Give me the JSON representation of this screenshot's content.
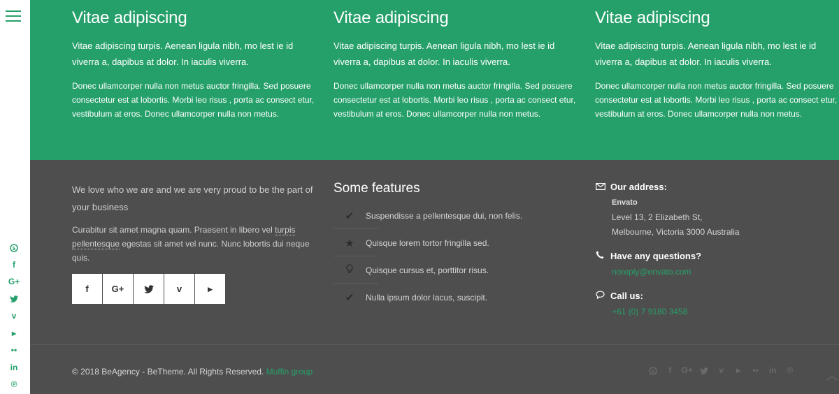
{
  "sidebar": {
    "social_icons": [
      "skype-icon",
      "facebook-icon",
      "google-plus-icon",
      "twitter-icon",
      "vimeo-icon",
      "youtube-icon",
      "flickr-icon",
      "linkedin-icon",
      "pinterest-icon"
    ]
  },
  "columns": [
    {
      "title": "Vitae adipiscing",
      "lead": "Vitae adipiscing turpis. Aenean ligula nibh, mo lest ie id viverra a, dapibus at dolor. In iaculis viverra.",
      "body": "Donec ullamcorper nulla non metus auctor fringilla. Sed posuere consectetur est at lobortis. Morbi leo risus , porta ac consect etur, vestibulum at eros. Donec ullamcorper nulla non metus."
    },
    {
      "title": "Vitae adipiscing",
      "lead": "Vitae adipiscing turpis. Aenean ligula nibh, mo lest ie id viverra a, dapibus at dolor. In iaculis viverra.",
      "body": "Donec ullamcorper nulla non metus auctor fringilla. Sed posuere consectetur est at lobortis. Morbi leo risus , porta ac consect etur, vestibulum at eros. Donec ullamcorper nulla non metus."
    },
    {
      "title": "Vitae adipiscing",
      "lead": "Vitae adipiscing turpis. Aenean ligula nibh, mo lest ie id viverra a, dapibus at dolor. In iaculis viverra.",
      "body": "Donec ullamcorper nulla non metus auctor fringilla. Sed posuere consectetur est at lobortis. Morbi leo risus , porta ac consect etur, vestibulum at eros. Donec ullamcorper nulla non metus."
    }
  ],
  "about": {
    "tagline": "We love who we are and we are very proud to be the part of your business",
    "body_start": "Curabitur sit amet magna quam. Praesent in libero vel ",
    "body_link": "turpis pellentesque",
    "body_end": " egestas sit amet vel nunc. Nunc lobortis dui neque quis."
  },
  "social_buttons": [
    "facebook-icon",
    "google-plus-icon",
    "twitter-icon",
    "vimeo-icon",
    "youtube-icon"
  ],
  "features": {
    "title": "Some features",
    "items": [
      {
        "icon": "check-icon",
        "text": "Suspendisse a pellentesque dui, non felis."
      },
      {
        "icon": "star-icon",
        "text": "Quisque lorem tortor fringilla sed."
      },
      {
        "icon": "lightbulb-icon",
        "text": "Quisque cursus et, porttitor risus."
      },
      {
        "icon": "check-icon",
        "text": "Nulla ipsum dolor lacus, suscipit."
      }
    ]
  },
  "contact": {
    "address_title": "Our address:",
    "company": "Envato",
    "address_line1": "Level 13, 2 Elizabeth St,",
    "address_line2": "Melbourne, Victoria 3000 Australia",
    "questions_title": "Have any questions?",
    "email": "noreply@envato.com",
    "call_title": "Call us:",
    "phone": "+61 (0) 7 9180 3458"
  },
  "footer": {
    "copyright": "© 2018 BeAgency - BeTheme. All Rights Reserved. ",
    "author_link": "Muffin group"
  },
  "colors": {
    "accent": "#26a06a",
    "footer_bg": "#4f4e4e"
  }
}
